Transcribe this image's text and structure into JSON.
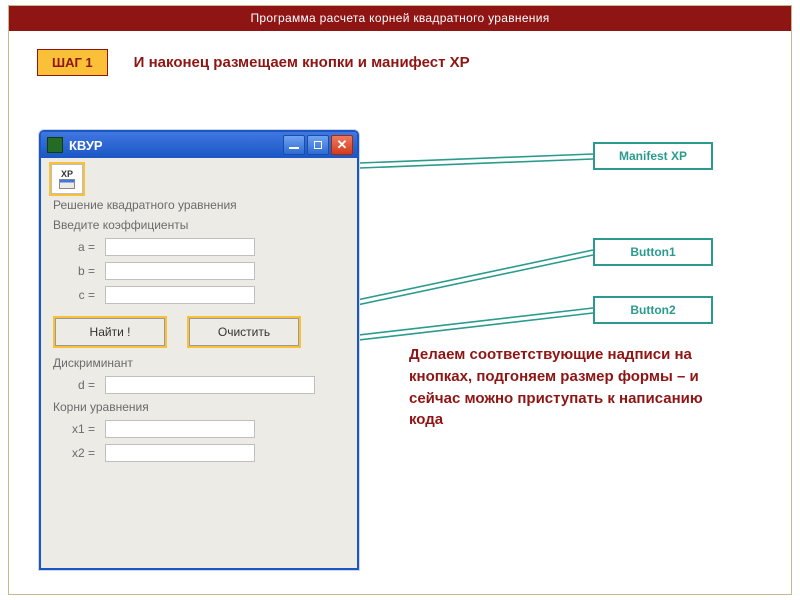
{
  "header": {
    "title": "Программа расчета корней квадратного уравнения"
  },
  "step": {
    "badge": "ШАГ 1",
    "text": "И наконец размещаем кнопки и манифест XP"
  },
  "labels": {
    "manifest": "Manifest XP",
    "button1": "Button1",
    "button2": "Button2"
  },
  "window": {
    "title": "КВУР",
    "xp_label": "XP",
    "heading": "Решение квадратного уравнения",
    "coeff_title": "Введите коэффициенты",
    "coeff": {
      "a": "a =",
      "b": "b =",
      "c": "c ="
    },
    "btn_find": "Найти !",
    "btn_clear": "Очистить",
    "disc_title": "Дискриминант",
    "disc_label": "d =",
    "roots_title": "Корни уравнения",
    "roots": {
      "x1": "x1 =",
      "x2": "x2 ="
    }
  },
  "description": "   Делаем соответствующие надписи на кнопках, подгоняем размер формы – и сейчас можно приступать к написанию кода"
}
